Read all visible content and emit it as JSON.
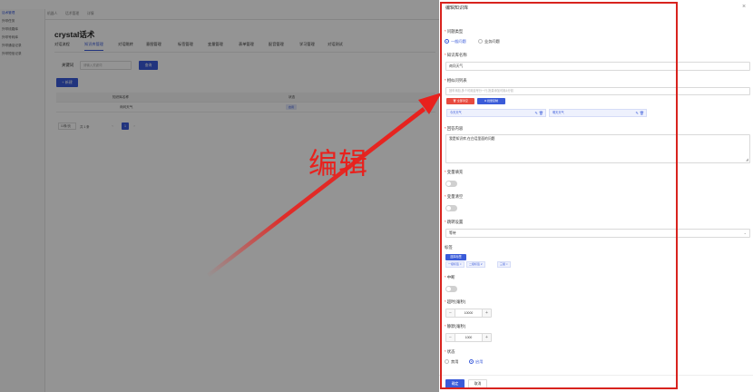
{
  "sidebar": {
    "items": [
      {
        "label": "话术管理"
      },
      {
        "label": "外呼任务"
      },
      {
        "label": "外呼线路库"
      },
      {
        "label": "外呼号码库"
      },
      {
        "label": "外呼通话记录"
      },
      {
        "label": "外呼短信记录"
      }
    ]
  },
  "breadcrumb": [
    "机器人",
    "话术管理",
    "详情"
  ],
  "page": {
    "title": "crystal话术",
    "tabs": [
      "对话流程",
      "知识库管理",
      "对话跳转",
      "意图管理",
      "标签管理",
      "变量管理",
      "表单管理",
      "配音管理",
      "学习管理",
      "对话测试"
    ],
    "search": {
      "label": "关键词",
      "placeholder": "请输入关键词",
      "button": "查询"
    },
    "new_button": "+ 新建",
    "table": {
      "headers": [
        "知识库名称",
        "状态"
      ],
      "rows": [
        {
          "name": "询问天气",
          "status": "启用"
        }
      ]
    },
    "pager": {
      "size": "10条/页",
      "total": "共 1 条",
      "prev": "‹",
      "next": "›",
      "page": "1"
    }
  },
  "annotation": {
    "text": "编辑",
    "color": "#e8211d"
  },
  "drawer": {
    "title": "编辑知识库",
    "close": "×",
    "question_type": {
      "label": "问题类型",
      "options": [
        "一般问题",
        "业务问题"
      ],
      "selected": "一般问题"
    },
    "kb_name": {
      "label": "知识库名称",
      "value": "询问天气"
    },
    "similar": {
      "label": "相似问列表",
      "placeholder": "回车添加,多个可用逗号分一行,批量添加可用&分割",
      "clear_button": "全部清空",
      "import_button": "批量复制",
      "items": [
        "今天天气",
        "明天天气"
      ],
      "item_icons": "✎ 🗑"
    },
    "answer": {
      "label": "回答内容",
      "value": "我是知识库,在白话里面的问题"
    },
    "var_fill": {
      "label": "变量填充"
    },
    "var_clear": {
      "label": "变量清空"
    },
    "jump": {
      "label": "跳转设置",
      "value": "等待"
    },
    "tags": {
      "label": "标签",
      "button": "选择标签",
      "items": [
        "一级标签 ×",
        "二级标签 2",
        "三级 ×"
      ]
    },
    "interrupt": {
      "label": "中断"
    },
    "timeout": {
      "label": "超时(毫秒)",
      "value": "10000"
    },
    "silence": {
      "label": "静默(毫秒)",
      "value": "1000"
    },
    "status": {
      "label": "状态",
      "options": [
        "禁用",
        "启用"
      ],
      "selected": "启用"
    },
    "ok_button": "确定",
    "cancel_button": "取消"
  },
  "colors": {
    "accent": "#3a5bd9",
    "annotation": "#e8211d",
    "danger": "#e53935"
  }
}
